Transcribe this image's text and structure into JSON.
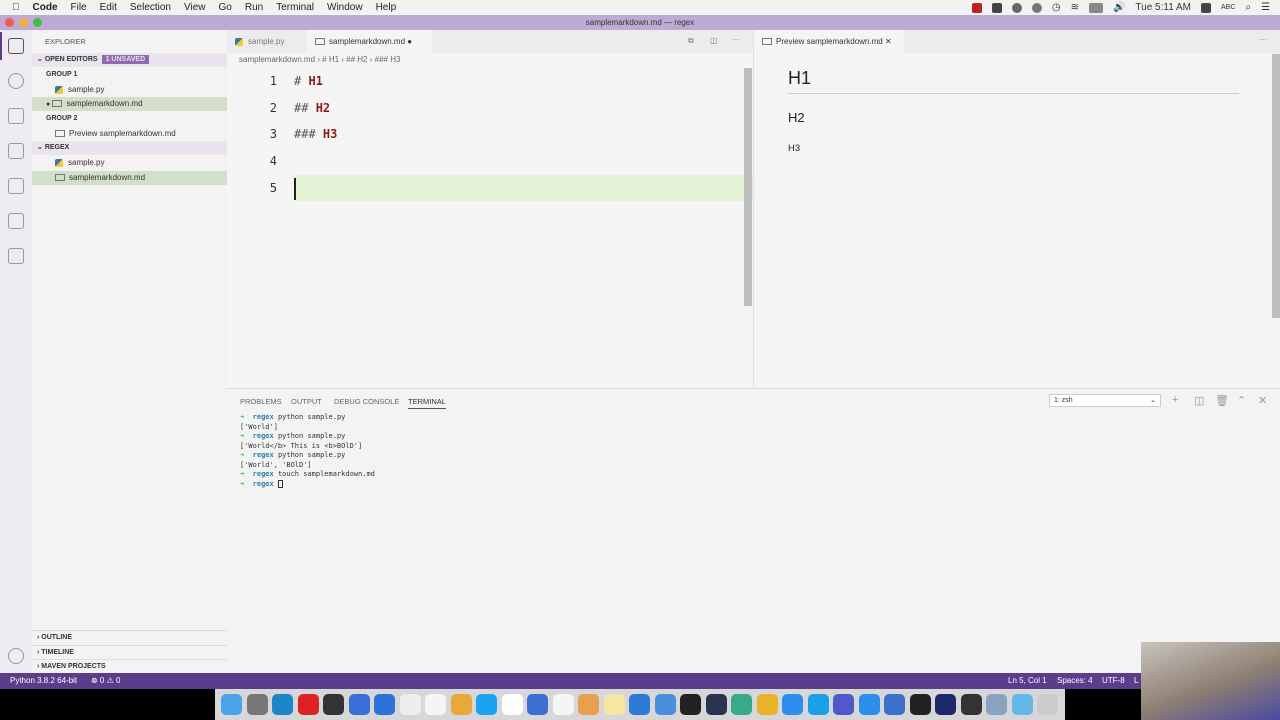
{
  "menubar": {
    "app": "Code",
    "items": [
      "File",
      "Edit",
      "Selection",
      "View",
      "Go",
      "Run",
      "Terminal",
      "Window",
      "Help"
    ],
    "clock": "Tue 5:11 AM",
    "input": "ABC"
  },
  "window": {
    "title": "samplemarkdown.md — regex"
  },
  "sidebar": {
    "title": "EXPLORER",
    "open_editors": "OPEN EDITORS",
    "unsaved_badge": "1 UNSAVED",
    "group1": "GROUP 1",
    "group1_items": [
      "sample.py",
      "samplemarkdown.md"
    ],
    "group2": "GROUP 2",
    "group2_items": [
      "Preview samplemarkdown.md"
    ],
    "folder": "REGEX",
    "folder_items": [
      "sample.py",
      "samplemarkdown.md"
    ],
    "outline": "OUTLINE",
    "timeline": "TIMELINE",
    "maven": "MAVEN PROJECTS"
  },
  "editor": {
    "tabs": [
      "sample.py",
      "samplemarkdown.md"
    ],
    "breadcrumb": [
      "samplemarkdown.md",
      "# H1",
      "## H2",
      "### H3"
    ],
    "lines": [
      {
        "n": "1",
        "mark": "# ",
        "text": "H1"
      },
      {
        "n": "2",
        "mark": "## ",
        "text": "H2"
      },
      {
        "n": "3",
        "mark": "### ",
        "text": "H3"
      },
      {
        "n": "4",
        "mark": "",
        "text": ""
      },
      {
        "n": "5",
        "mark": "",
        "text": ""
      }
    ]
  },
  "preview": {
    "tab": "Preview samplemarkdown.md",
    "h1": "H1",
    "h2": "H2",
    "h3": "H3"
  },
  "panel": {
    "tabs": [
      "PROBLEMS",
      "OUTPUT",
      "DEBUG CONSOLE",
      "TERMINAL"
    ],
    "shell": "1: zsh",
    "terminal": [
      {
        "prompt": "regex",
        "cmd": "python sample.py"
      },
      {
        "out": "['World']"
      },
      {
        "prompt": "regex",
        "cmd": "python sample.py"
      },
      {
        "out": "['World</b> This is <b>BOlD']"
      },
      {
        "prompt": "regex",
        "cmd": "python sample.py"
      },
      {
        "out": "['World', 'BOlD']"
      },
      {
        "prompt": "regex",
        "cmd": "touch samplemarkdown.md"
      },
      {
        "prompt": "regex",
        "cmd": ""
      }
    ]
  },
  "statusbar": {
    "python": "Python 3.8.2 64-bit",
    "problems": "⊗ 0 ⚠ 0",
    "position": "Ln 5, Col 1",
    "spaces": "Spaces: 4",
    "encoding": "UTF-8",
    "eol": "L"
  },
  "colors": {
    "accent": "#5c3d8c",
    "titlebar": "#bfaad3",
    "selection": "#d3dfc9",
    "heading_code": "#8b1a1a"
  }
}
